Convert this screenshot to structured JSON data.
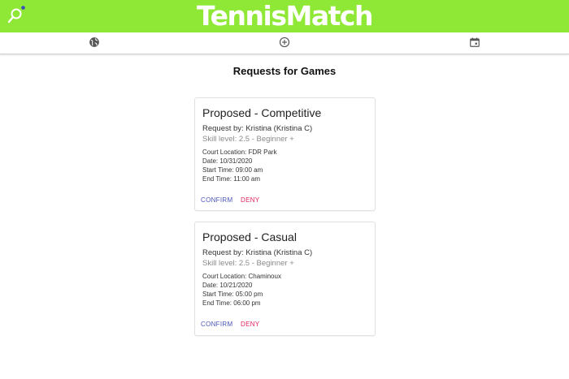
{
  "app": {
    "title": "TennisMatch",
    "brand_color": "#8fe835"
  },
  "nav": {
    "items": [
      {
        "icon": "globe-icon"
      },
      {
        "icon": "add-circle-icon"
      },
      {
        "icon": "calendar-icon"
      }
    ]
  },
  "page": {
    "title": "Requests for Games"
  },
  "requests": [
    {
      "title": "Proposed - Competitive",
      "requester": "Request by: Kristina (Kristina C)",
      "skill": "Skill level: 2.5 - Beginner +",
      "location": "Court Location: FDR Park",
      "date": "Date: 10/31/2020",
      "start": "Start Time: 09:00 am",
      "end": "End Time: 11:00 am",
      "confirm_label": "CONFIRM",
      "deny_label": "DENY"
    },
    {
      "title": "Proposed - Casual",
      "requester": "Request by: Kristina (Kristina C)",
      "skill": "Skill level: 2.5 - Beginner +",
      "location": "Court Location: Chaminoux",
      "date": "Date: 10/21/2020",
      "start": "Start Time: 05:00 pm",
      "end": "End Time: 06:00 pm",
      "confirm_label": "CONFIRM",
      "deny_label": "DENY"
    }
  ]
}
